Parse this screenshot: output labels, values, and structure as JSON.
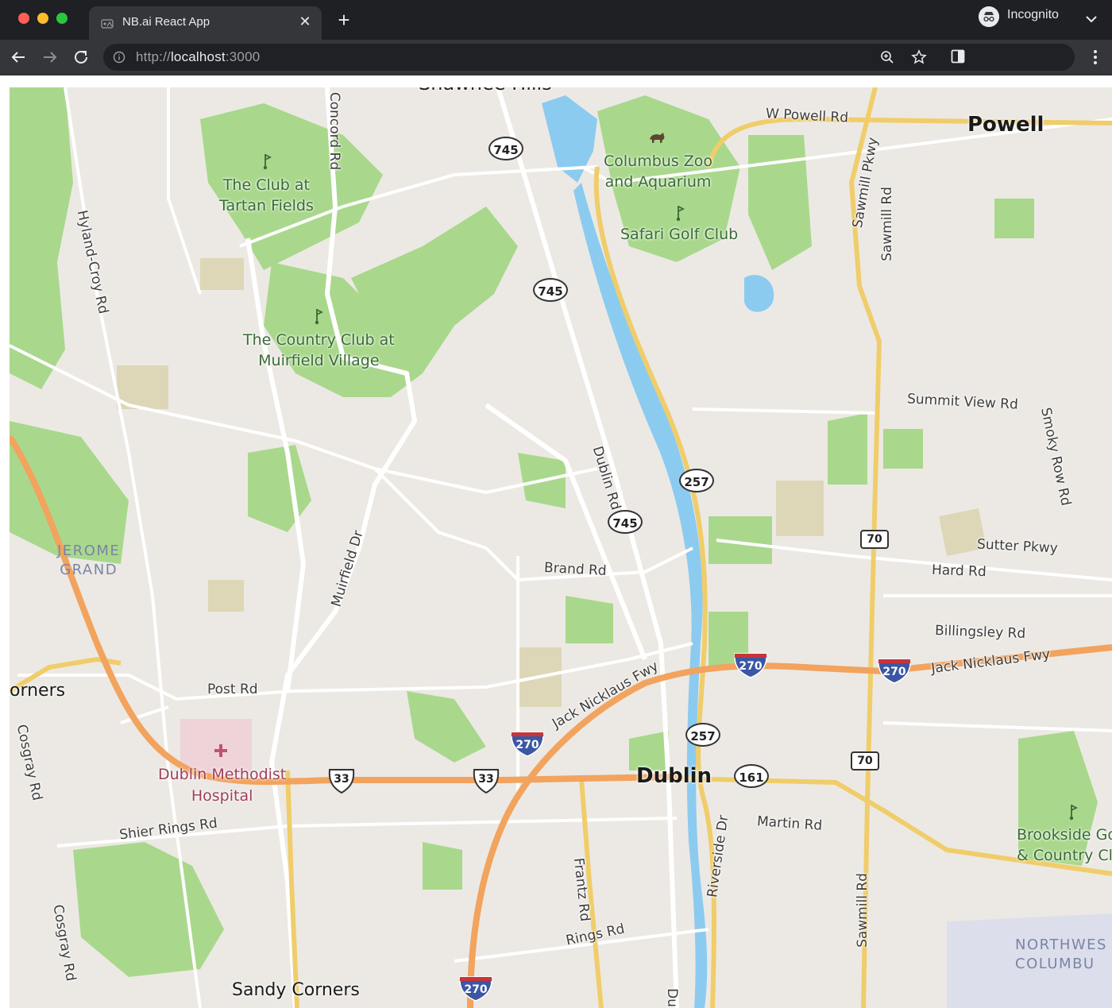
{
  "browser": {
    "tab_title": "NB.ai React App",
    "tab_close": "✕",
    "new_tab": "+",
    "url_scheme": "http://",
    "url_host": "localhost",
    "url_port": ":3000",
    "incognito_label": "Incognito"
  },
  "map": {
    "places": {
      "shawnee": "Shawnee Hills",
      "tartan_1": "The Club at",
      "tartan_2": "Tartan Fields",
      "zoo_1": "Columbus Zoo",
      "zoo_2": "and Aquarium",
      "safari": "Safari Golf Club",
      "muirfield_1": "The Country Club at",
      "muirfield_2": "Muirfield Village",
      "brookside_1": "Brookside Go",
      "brookside_2": "& Country Cl"
    },
    "cities": {
      "powell": "Powell",
      "dublin": "Dublin",
      "sandy": "Sandy Corners",
      "corners": "orners"
    },
    "areas": {
      "jerome_1": "JEROME",
      "jerome_2": "GRAND",
      "northwest_1": "NORTHWES",
      "northwest_2": "COLUMBU"
    },
    "hospital": {
      "line1": "Dublin Methodist",
      "line2": "Hospital"
    },
    "streets": {
      "w_powell": "W Powell Rd",
      "concord": "Concord Rd",
      "hyland_croy": "Hyland-Croy Rd",
      "sawmill_pkwy": "Sawmill Pkwy",
      "sawmill_rd_top": "Sawmill Rd",
      "summit_view": "Summit View Rd",
      "smoky_row": "Smoky Row Rd",
      "dublin_rd": "Dublin Rd",
      "muirfield_dr": "Muirfield Dr",
      "brand": "Brand Rd",
      "sutter": "Sutter Pkwy",
      "hard": "Hard Rd",
      "billingsley": "Billingsley Rd",
      "jack_east": "Jack Nicklaus Fwy",
      "jack_west": "Jack Nicklaus Fwy",
      "post": "Post Rd",
      "cosgray_top": "Cosgray Rd",
      "cosgray_bottom": "Cosgray Rd",
      "shier": "Shier Rings Rd",
      "martin": "Martin Rd",
      "riverside": "Riverside Dr",
      "sawmill_rd_bottom": "Sawmill Rd",
      "frantz": "Frantz Rd",
      "rings": "Rings Rd",
      "du": "Du"
    },
    "shields": {
      "sr745": "745",
      "sr257": "257",
      "sr161": "161",
      "sr70": "70",
      "us33": "33",
      "i270": "270"
    },
    "colors": {
      "land": "#ece9e4",
      "park": "#a9d88c",
      "water": "#8ccbf0",
      "highway": "#f2a35e",
      "arterial": "#f0cd6a",
      "road": "#ffffff",
      "interstate_shield": "#3b57a3"
    }
  }
}
